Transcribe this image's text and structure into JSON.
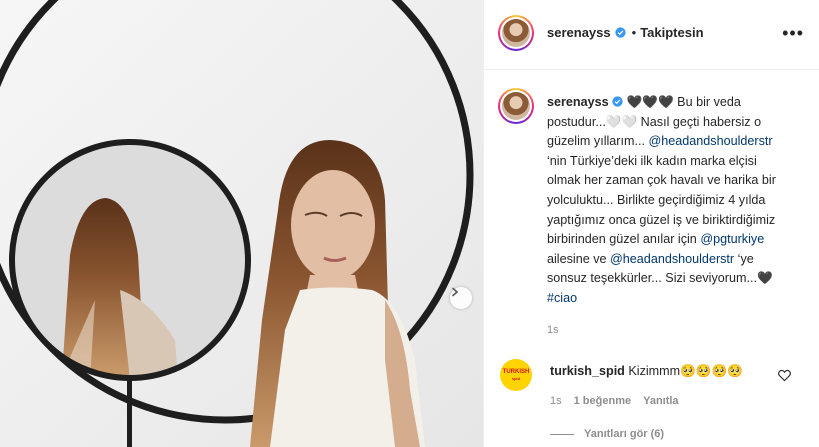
{
  "post": {
    "username": "serenayss",
    "follow_separator": "•",
    "follow_status": "Takiptesin",
    "more_label": "•••"
  },
  "caption": {
    "username": "serenayss",
    "hearts": "🖤🖤🖤",
    "text_1": " Bu bir veda postudur...🤍🤍 Nasıl geçti habersiz o güzelim yıllarım... ",
    "mention_1": "@headandshoulderstr",
    "text_2": " ‘nin Türkiye’deki ilk kadın marka elçisi olmak her zaman çok havalı ve harika bir yolculuktu... Birlikte geçirdiğimiz 4 yılda yaptığımız onca güzel iş ve biriktirdiğimiz birbirinden güzel anılar için ",
    "mention_2": "@pgturkiye",
    "text_3": " ailesine ve ",
    "mention_3": "@headandshoulderstr",
    "text_4": " ‘ye sonsuz teşekkürler... Sizi seviyorum...🖤 ",
    "hashtag": "#ciao",
    "time": "1s"
  },
  "comment": {
    "avatar_text_top": "TURKISH",
    "avatar_text_bottom": "spid",
    "username": "turkish_spid",
    "text": "Kizimmm🥺🥺🥺🥺",
    "time": "1s",
    "likes": "1 beğenme",
    "reply": "Yanıtla",
    "view_replies": "Yanıtları gör (6)"
  },
  "colors": {
    "link": "#00376b",
    "verified": "#3897f0",
    "muted": "#8e8e8e",
    "text": "#262626"
  },
  "icons": {
    "verified": "verified-badge-icon",
    "heart": "heart-outline-icon",
    "next": "chevron-right-icon",
    "more": "more-options-icon"
  }
}
